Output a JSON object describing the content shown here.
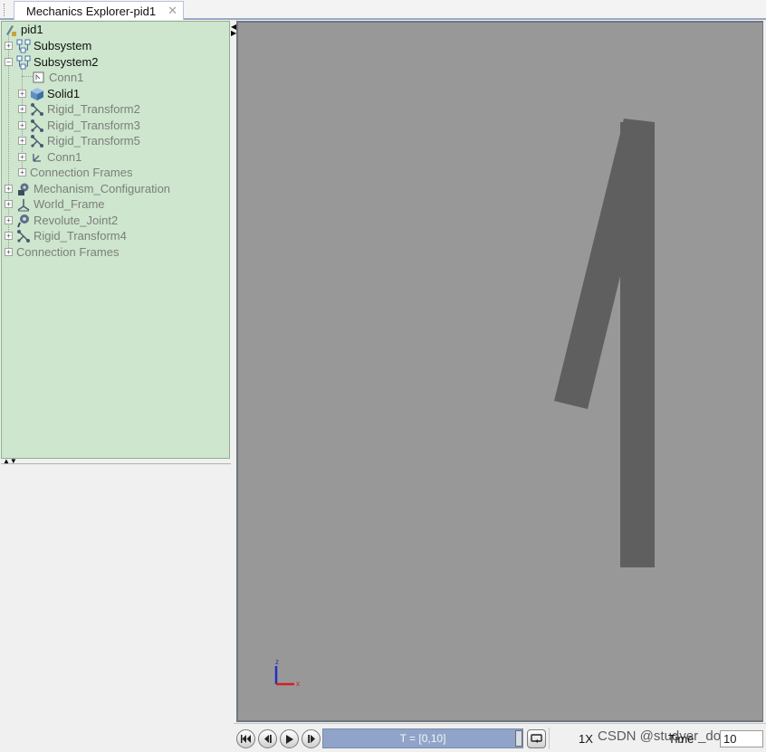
{
  "tab": {
    "title": "Mechanics Explorer-pid1",
    "close": "✕"
  },
  "tree": {
    "root": "pid1",
    "subsystem": "Subsystem",
    "subsystem2": "Subsystem2",
    "conn1_a": "Conn1",
    "solid1": "Solid1",
    "rigid_transform2": "Rigid_Transform2",
    "rigid_transform3": "Rigid_Transform3",
    "rigid_transform5": "Rigid_Transform5",
    "conn1_b": "Conn1",
    "connection_frames_inner": "Connection Frames",
    "mechanism_configuration": "Mechanism_Configuration",
    "world_frame": "World_Frame",
    "revolute_joint2": "Revolute_Joint2",
    "rigid_transform4": "Rigid_Transform4",
    "connection_frames": "Connection Frames"
  },
  "viewport": {
    "background": "#989898",
    "body_color": "#5f5f5f",
    "axes": {
      "z": "z",
      "x": "x"
    }
  },
  "toolbar": {
    "timeline": "T = [0,10]",
    "speed": "1X",
    "watermark": "CSDN @studyer_domi",
    "time_label": "Time",
    "time_value": "10"
  }
}
